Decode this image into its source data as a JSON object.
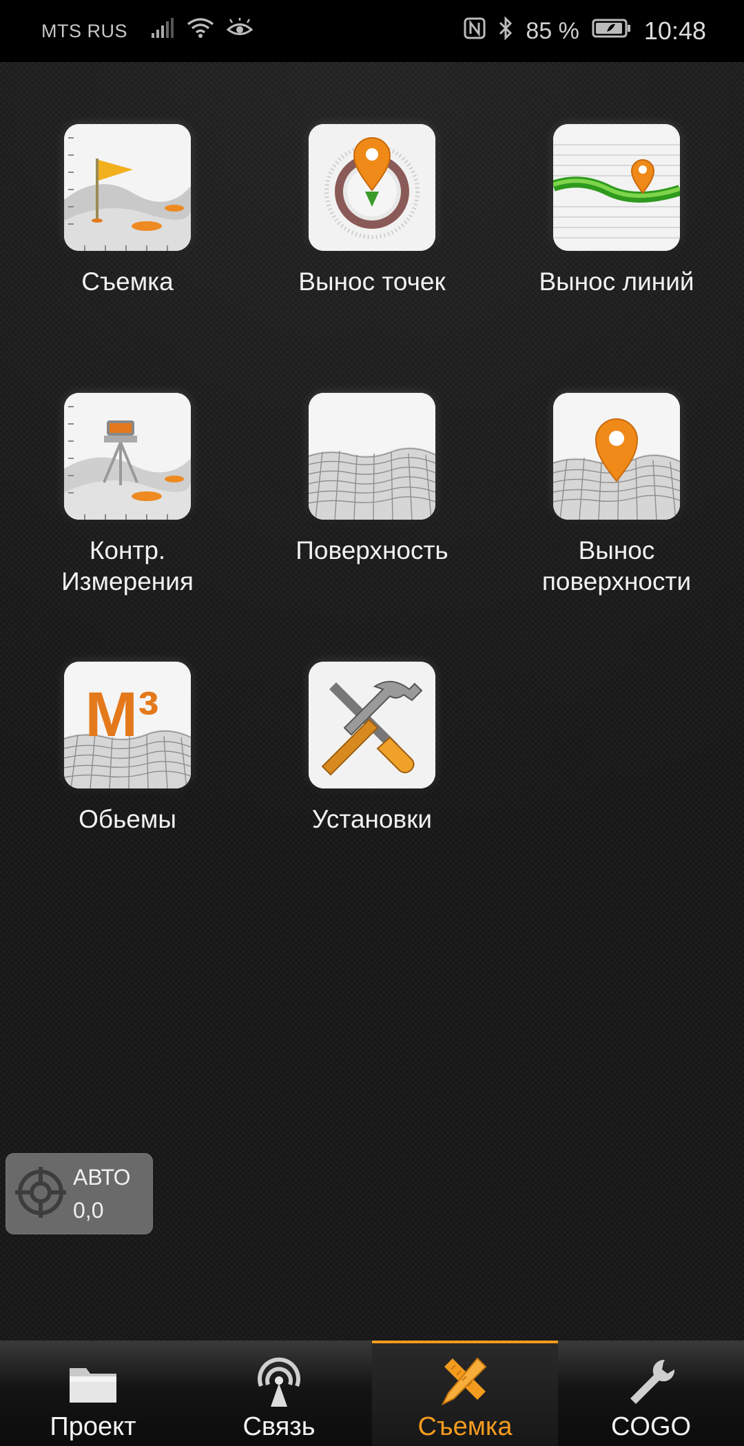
{
  "status_bar": {
    "carrier": "MTS RUS",
    "battery_percent": "85 %",
    "time": "10:48"
  },
  "tiles": [
    {
      "label": "Съемка",
      "icon": "survey-flag-icon"
    },
    {
      "label": "Вынос точек",
      "icon": "stakeout-points-icon"
    },
    {
      "label": "Вынос линий",
      "icon": "stakeout-lines-icon"
    },
    {
      "label": "Контр.\nИзмерения",
      "icon": "control-measure-icon"
    },
    {
      "label": "Поверхность",
      "icon": "surface-icon"
    },
    {
      "label": "Вынос\nповерхности",
      "icon": "stakeout-surface-icon"
    },
    {
      "label": "Обьемы",
      "icon": "volumes-icon"
    },
    {
      "label": "Установки",
      "icon": "settings-tools-icon"
    }
  ],
  "volume_icon_text": "M³",
  "gps": {
    "mode": "АВТО",
    "value": "0,0"
  },
  "nav": [
    {
      "label": "Проект",
      "icon": "folder-icon"
    },
    {
      "label": "Связь",
      "icon": "antenna-icon"
    },
    {
      "label": "Съемка",
      "icon": "pencil-ruler-icon",
      "active": true
    },
    {
      "label": "COGO",
      "icon": "wrench-icon"
    }
  ],
  "colors": {
    "accent": "#f39b1e",
    "background": "#171717"
  }
}
